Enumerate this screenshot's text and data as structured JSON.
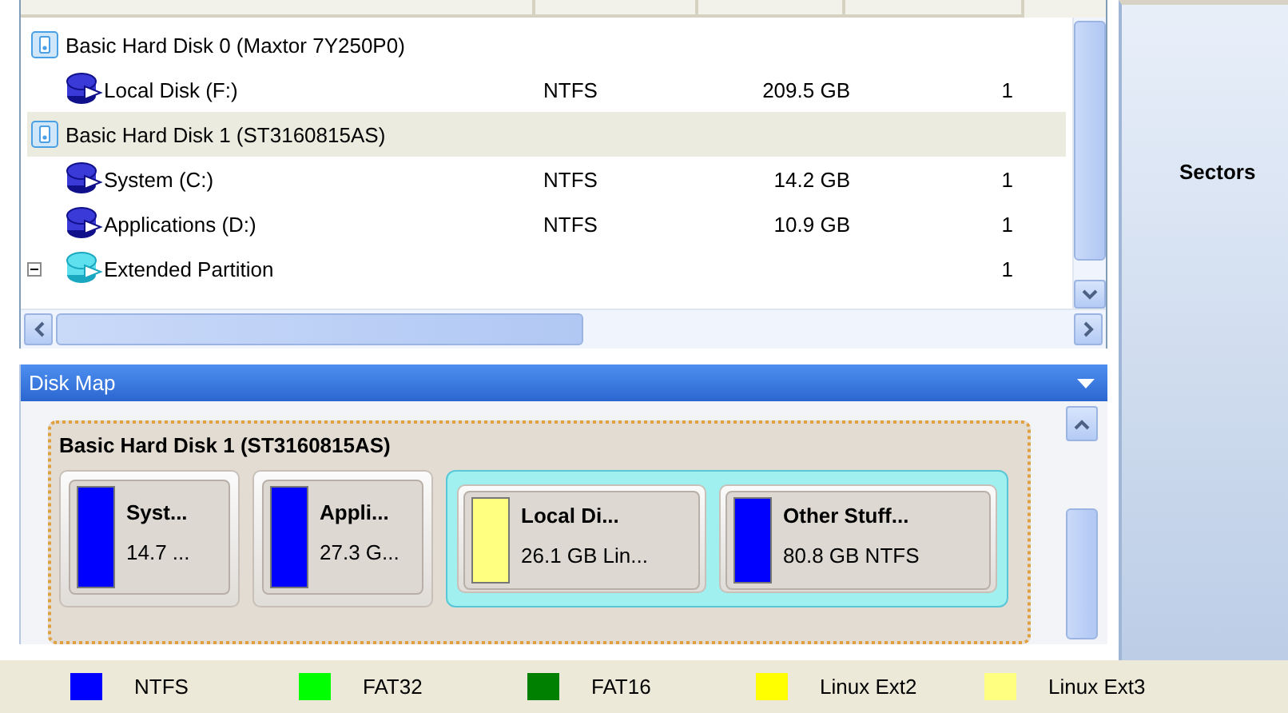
{
  "tree": {
    "rows": [
      {
        "name": "Basic Hard Disk 0 (Maxtor 7Y250P0)",
        "kind": "disk",
        "selected": false,
        "children": [
          {
            "name": "Local Disk (F:)",
            "kind": "partition",
            "file_system": "NTFS",
            "size": "209.5 GB",
            "column_4": "1",
            "selected": false
          }
        ]
      },
      {
        "name": "Basic Hard Disk 1 (ST3160815AS)",
        "kind": "disk",
        "selected": true,
        "children": [
          {
            "name": "System (C:)",
            "kind": "partition",
            "file_system": "NTFS",
            "size": "14.2 GB",
            "column_4": "1",
            "selected": false
          },
          {
            "name": "Applications (D:)",
            "kind": "partition",
            "file_system": "NTFS",
            "size": "10.9 GB",
            "column_4": "1",
            "selected": false
          },
          {
            "name": "Extended Partition",
            "kind": "extended",
            "expanded": true,
            "column_4": "1",
            "selected": false
          }
        ]
      }
    ]
  },
  "disk_map": {
    "title": "Disk Map",
    "disk": {
      "name": "Basic Hard Disk 1 (ST3160815AS)",
      "partitions": [
        {
          "kind": "partition",
          "name": "Syst...",
          "info": "14.7 ...",
          "color": "#0000ff"
        },
        {
          "kind": "partition",
          "name": "Appli...",
          "info": "27.3 G...",
          "color": "#0000ff"
        },
        {
          "kind": "extended",
          "children": [
            {
              "name": "Local Di...",
              "info": "26.1 GB Lin...",
              "color": "#ffff80"
            },
            {
              "name": "Other Stuff...",
              "info": "80.8 GB NTFS",
              "color": "#0000ff"
            }
          ]
        }
      ]
    }
  },
  "side_panel": {
    "heading": "Sectors"
  },
  "legend": [
    {
      "label": "NTFS",
      "color": "#0000ff"
    },
    {
      "label": "FAT32",
      "color": "#00ff00"
    },
    {
      "label": "FAT16",
      "color": "#008000"
    },
    {
      "label": "Linux Ext2",
      "color": "#ffff00"
    },
    {
      "label": "Linux Ext3",
      "color": "#ffff80"
    }
  ]
}
